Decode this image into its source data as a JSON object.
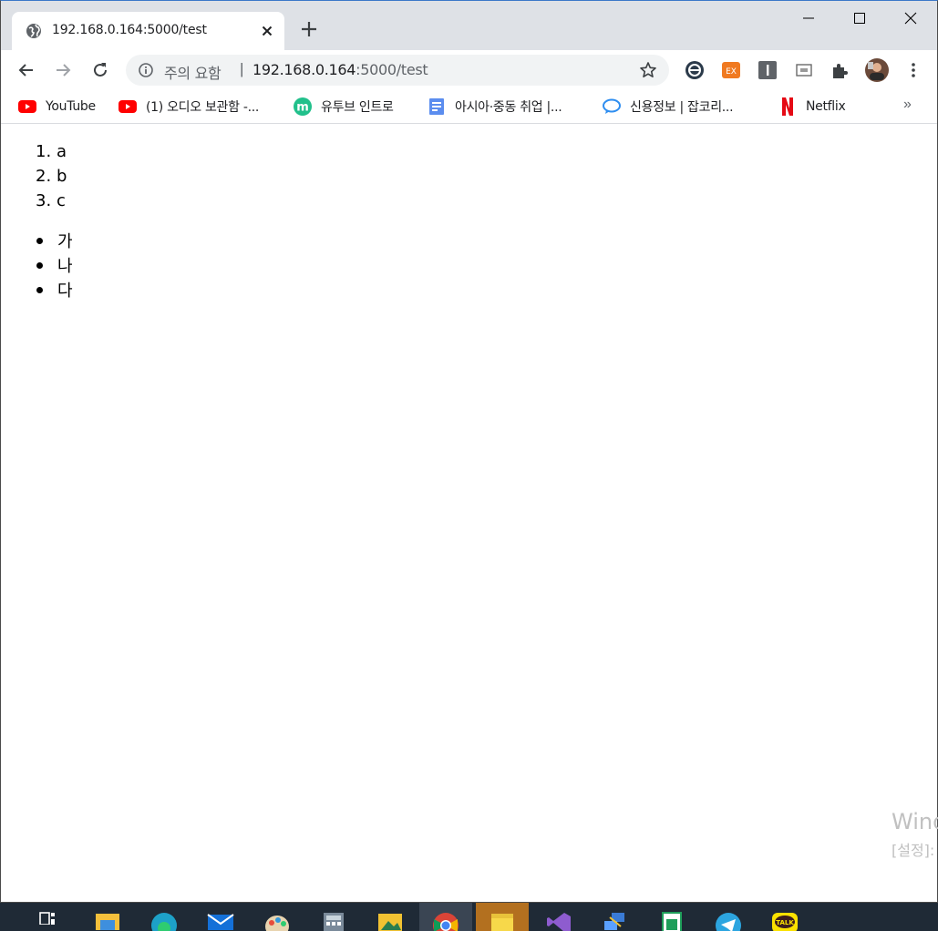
{
  "tab": {
    "title": "192.168.0.164:5000/test"
  },
  "window_controls": {
    "minimize": "minimize",
    "maximize": "maximize",
    "close": "close"
  },
  "omnibox": {
    "security_label": "주의 요함",
    "separator": "|",
    "url_host": "192.168.0.164",
    "url_path": ":5000/test"
  },
  "bookmarks": [
    {
      "label": "YouTube",
      "icon": "youtube-icon"
    },
    {
      "label": "(1) 오디오 보관함 -...",
      "icon": "youtube-icon"
    },
    {
      "label": "유투브 인트로",
      "icon": "m-logo-icon"
    },
    {
      "label": "아시아·중동 취업 |...",
      "icon": "page-icon"
    },
    {
      "label": "신용정보 | 잡코리...",
      "icon": "chat-bubble-icon"
    },
    {
      "label": "Netflix",
      "icon": "netflix-icon"
    }
  ],
  "bookmarks_more": "»",
  "content": {
    "ordered_list": [
      {
        "num": "1.",
        "text": "a"
      },
      {
        "num": "2.",
        "text": "b"
      },
      {
        "num": "3.",
        "text": "c"
      }
    ],
    "unordered_list": [
      "가",
      "나",
      "다"
    ]
  },
  "watermark": {
    "line1": "Wind",
    "line2": "[설정]:"
  },
  "colors": {
    "tabstrip": "#dee1e6",
    "omnibox": "#f1f3f4",
    "taskbar": "#1f2a36"
  }
}
